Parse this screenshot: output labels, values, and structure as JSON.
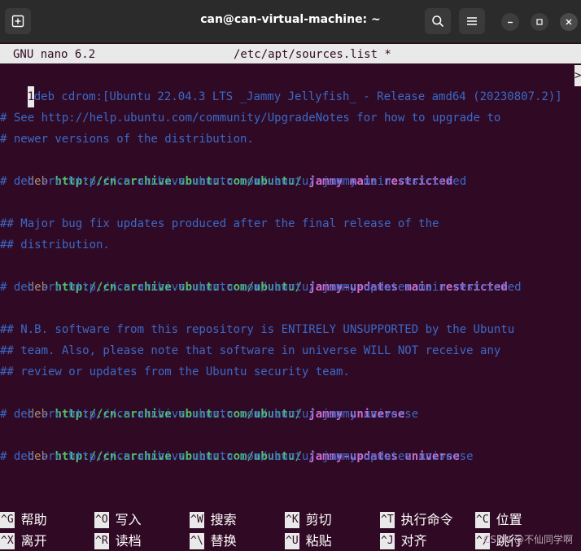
{
  "window": {
    "title": "can@can-virtual-machine: ~",
    "icons": [
      "new-tab-icon",
      "search-icon",
      "menu-icon",
      "minimize-icon",
      "maximize-icon",
      "close-icon"
    ]
  },
  "nano": {
    "version": "GNU nano 6.2",
    "filename": "/etc/apt/sources.list *"
  },
  "editor": {
    "line1_cursor": "1",
    "line1_rest": "deb cdrom:[Ubuntu 22.04.3 LTS _Jammy Jellyfish_ - Release amd64 (20230807.2)]",
    "overflow_marker": ">",
    "comment1": "# See http://help.ubuntu.com/community/UpgradeNotes for how to upgrade to",
    "comment2": "# newer versions of the distribution.",
    "r1_kw": "deb",
    "r1_url": "http://cn.archive.ubuntu.com/ubuntu/",
    "r1_suite": "jammy main restricted",
    "r1_src": "# deb-src http://cn.archive.ubuntu.com/ubuntu/ jammy main restricted",
    "comment3": "## Major bug fix updates produced after the final release of the",
    "comment4": "## distribution.",
    "r2_kw": "deb",
    "r2_url": "http://cn.archive.ubuntu.com/ubuntu/",
    "r2_suite": "jammy-updates main restricted",
    "r2_src": "# deb-src http://cn.archive.ubuntu.com/ubuntu/ jammy-updates main restricted",
    "comment5": "## N.B. software from this repository is ENTIRELY UNSUPPORTED by the Ubuntu",
    "comment6": "## team. Also, please note that software in universe WILL NOT receive any",
    "comment7": "## review or updates from the Ubuntu security team.",
    "r3_kw": "deb",
    "r3_url": "http://cn.archive.ubuntu.com/ubuntu/",
    "r3_suite": "jammy universe",
    "r3_src": "# deb-src http://cn.archive.ubuntu.com/ubuntu/ jammy universe",
    "r4_kw": "deb",
    "r4_url": "http://cn.archive.ubuntu.com/ubuntu/",
    "r4_suite": "jammy-updates universe",
    "r4_src": "# deb-src http://cn.archive.ubuntu.com/ubuntu/ jammy-updates universe"
  },
  "shortcuts": [
    {
      "key": "^G",
      "label": "帮助"
    },
    {
      "key": "^O",
      "label": "写入"
    },
    {
      "key": "^W",
      "label": "搜索"
    },
    {
      "key": "^K",
      "label": "剪切"
    },
    {
      "key": "^T",
      "label": "执行命令"
    },
    {
      "key": "^C",
      "label": "位置"
    },
    {
      "key": "^X",
      "label": "离开"
    },
    {
      "key": "^R",
      "label": "读档"
    },
    {
      "key": "^\\",
      "label": "替换"
    },
    {
      "key": "^U",
      "label": "粘贴"
    },
    {
      "key": "^J",
      "label": "对齐"
    },
    {
      "key": "^/",
      "label": "跳行"
    }
  ],
  "watermark": "CSDN @不仙同学啊",
  "colors": {
    "background": "#300a24",
    "comment": "#3a69c9",
    "keyword": "#c38b55",
    "url": "#4ec16d",
    "suite": "#c86ed1"
  }
}
